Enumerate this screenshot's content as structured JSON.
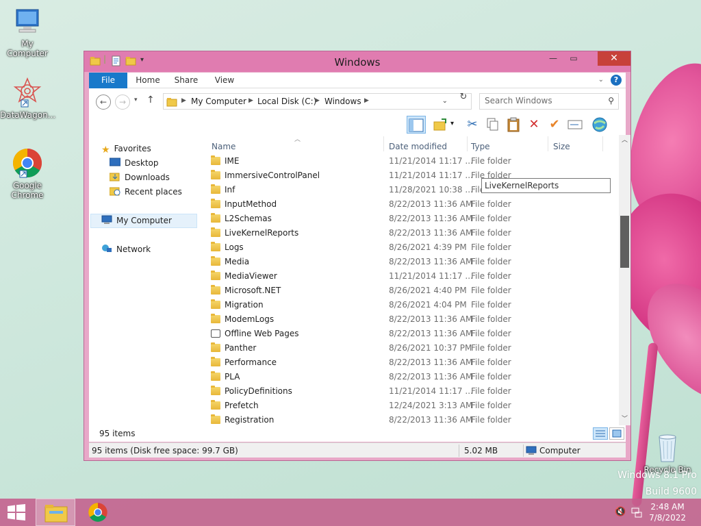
{
  "desktop": {
    "icons": [
      {
        "label": "My Computer"
      },
      {
        "label": "DataWagon..."
      },
      {
        "label": "Google Chrome"
      },
      {
        "label": "Recycle Bin"
      }
    ],
    "watermark_line1": "Windows 8.1 Pro",
    "watermark_line2": "Build 9600"
  },
  "window": {
    "title": "Windows",
    "tabs": [
      "File",
      "Home",
      "Share",
      "View"
    ],
    "help": "?",
    "address": {
      "crumbs": [
        "My Computer",
        "Local Disk (C:)",
        "Windows"
      ]
    },
    "search": {
      "placeholder": "Search Windows"
    },
    "navpane": {
      "favorites_label": "Favorites",
      "favorites": [
        "Desktop",
        "Downloads",
        "Recent places"
      ],
      "computer_label": "My Computer",
      "network_label": "Network"
    },
    "columns": {
      "name": "Name",
      "date": "Date modified",
      "type": "Type",
      "size": "Size"
    },
    "files": [
      {
        "name": "IME",
        "date": "11/21/2014 11:17 ...",
        "type": "File folder",
        "icon": "folder"
      },
      {
        "name": "ImmersiveControlPanel",
        "date": "11/21/2014 11:17 ...",
        "type": "File folder",
        "icon": "folder"
      },
      {
        "name": "Inf",
        "date": "11/28/2021 10:38 ...",
        "type": "File",
        "icon": "folder"
      },
      {
        "name": "InputMethod",
        "date": "8/22/2013 11:36 AM",
        "type": "File folder",
        "icon": "folder"
      },
      {
        "name": "L2Schemas",
        "date": "8/22/2013 11:36 AM",
        "type": "File folder",
        "icon": "folder"
      },
      {
        "name": "LiveKernelReports",
        "date": "8/22/2013 11:36 AM",
        "type": "File folder",
        "icon": "folder"
      },
      {
        "name": "Logs",
        "date": "8/26/2021 4:39 PM",
        "type": "File folder",
        "icon": "folder"
      },
      {
        "name": "Media",
        "date": "8/22/2013 11:36 AM",
        "type": "File folder",
        "icon": "folder"
      },
      {
        "name": "MediaViewer",
        "date": "11/21/2014 11:17 ...",
        "type": "File folder",
        "icon": "folder"
      },
      {
        "name": "Microsoft.NET",
        "date": "8/26/2021 4:40 PM",
        "type": "File folder",
        "icon": "folder"
      },
      {
        "name": "Migration",
        "date": "8/26/2021 4:04 PM",
        "type": "File folder",
        "icon": "folder"
      },
      {
        "name": "ModemLogs",
        "date": "8/22/2013 11:36 AM",
        "type": "File folder",
        "icon": "folder"
      },
      {
        "name": "Offline Web Pages",
        "date": "8/22/2013 11:36 AM",
        "type": "File folder",
        "icon": "special"
      },
      {
        "name": "Panther",
        "date": "8/26/2021 10:37 PM",
        "type": "File folder",
        "icon": "folder"
      },
      {
        "name": "Performance",
        "date": "8/22/2013 11:36 AM",
        "type": "File folder",
        "icon": "folder"
      },
      {
        "name": "PLA",
        "date": "8/22/2013 11:36 AM",
        "type": "File folder",
        "icon": "folder"
      },
      {
        "name": "PolicyDefinitions",
        "date": "11/21/2014 11:17 ...",
        "type": "File folder",
        "icon": "folder"
      },
      {
        "name": "Prefetch",
        "date": "12/24/2021 3:13 AM",
        "type": "File folder",
        "icon": "folder"
      },
      {
        "name": "Registration",
        "date": "8/22/2013 11:36 AM",
        "type": "File folder",
        "icon": "folder"
      }
    ],
    "tooltip": "LiveKernelReports",
    "items_count": "95 items",
    "status": {
      "left": "95 items (Disk free space: 99.7 GB)",
      "size": "5.02 MB",
      "location": "Computer"
    }
  },
  "taskbar": {
    "time": "2:48 AM",
    "date": "7/8/2022"
  },
  "colors": {
    "accent": "#1979ca",
    "window_frame": "#e07cb0",
    "close": "#c7413a"
  }
}
